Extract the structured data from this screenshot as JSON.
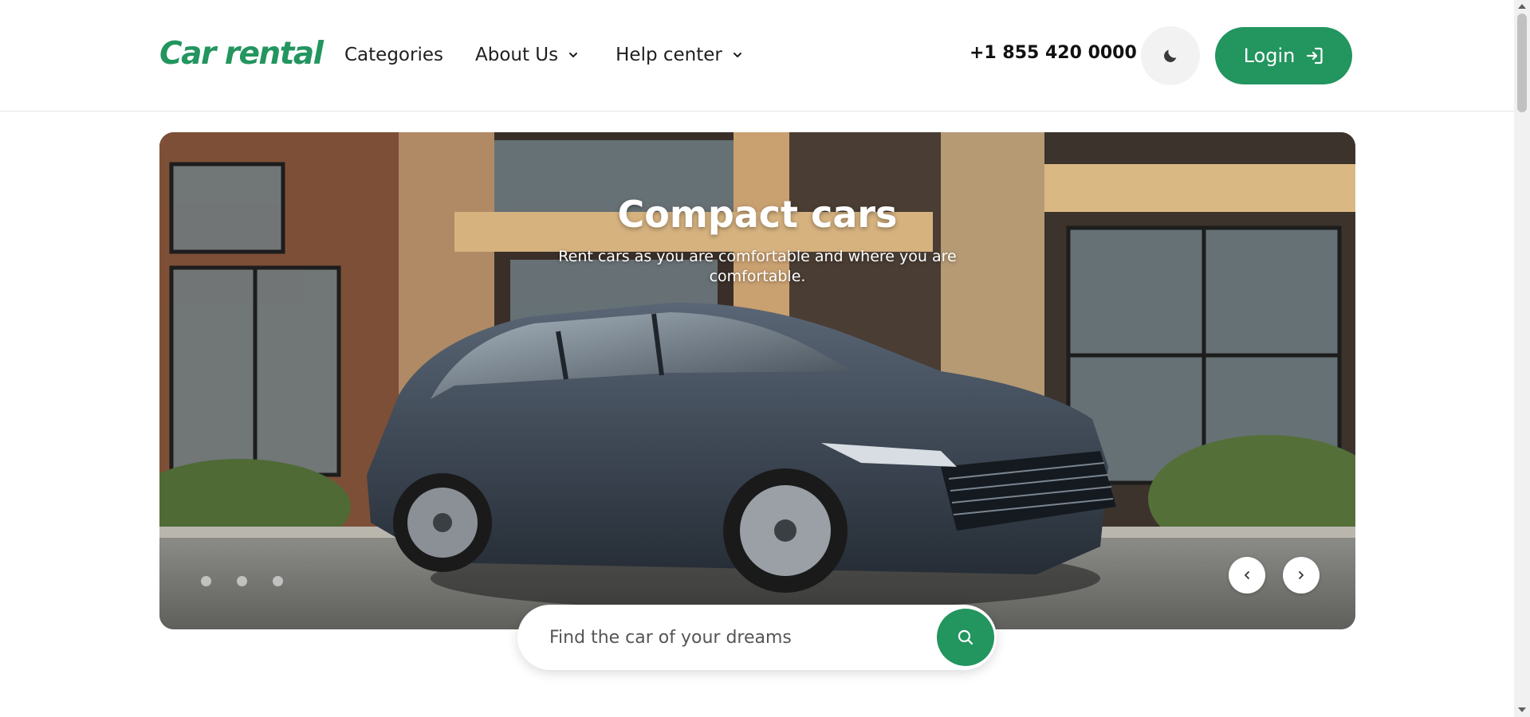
{
  "header": {
    "logo": "Car rental",
    "nav": [
      {
        "label": "Categories",
        "has_dropdown": false
      },
      {
        "label": "About Us",
        "has_dropdown": true
      },
      {
        "label": "Help center",
        "has_dropdown": true
      }
    ],
    "phone": "+1 855 420 0000",
    "theme_toggle_icon": "moon-icon",
    "login_label": "Login",
    "login_icon": "sign-in-icon"
  },
  "hero": {
    "title": "Compact cars",
    "subtitle": "Rent cars as you are comfortable and where you are comfortable.",
    "slide_count": 3,
    "active_slide": 1
  },
  "search": {
    "placeholder": "Find the car of your dreams",
    "button_icon": "search-icon"
  },
  "colors": {
    "accent": "#23955f",
    "text": "#1f1f1f",
    "theme_button_bg": "#f2f2f2"
  }
}
